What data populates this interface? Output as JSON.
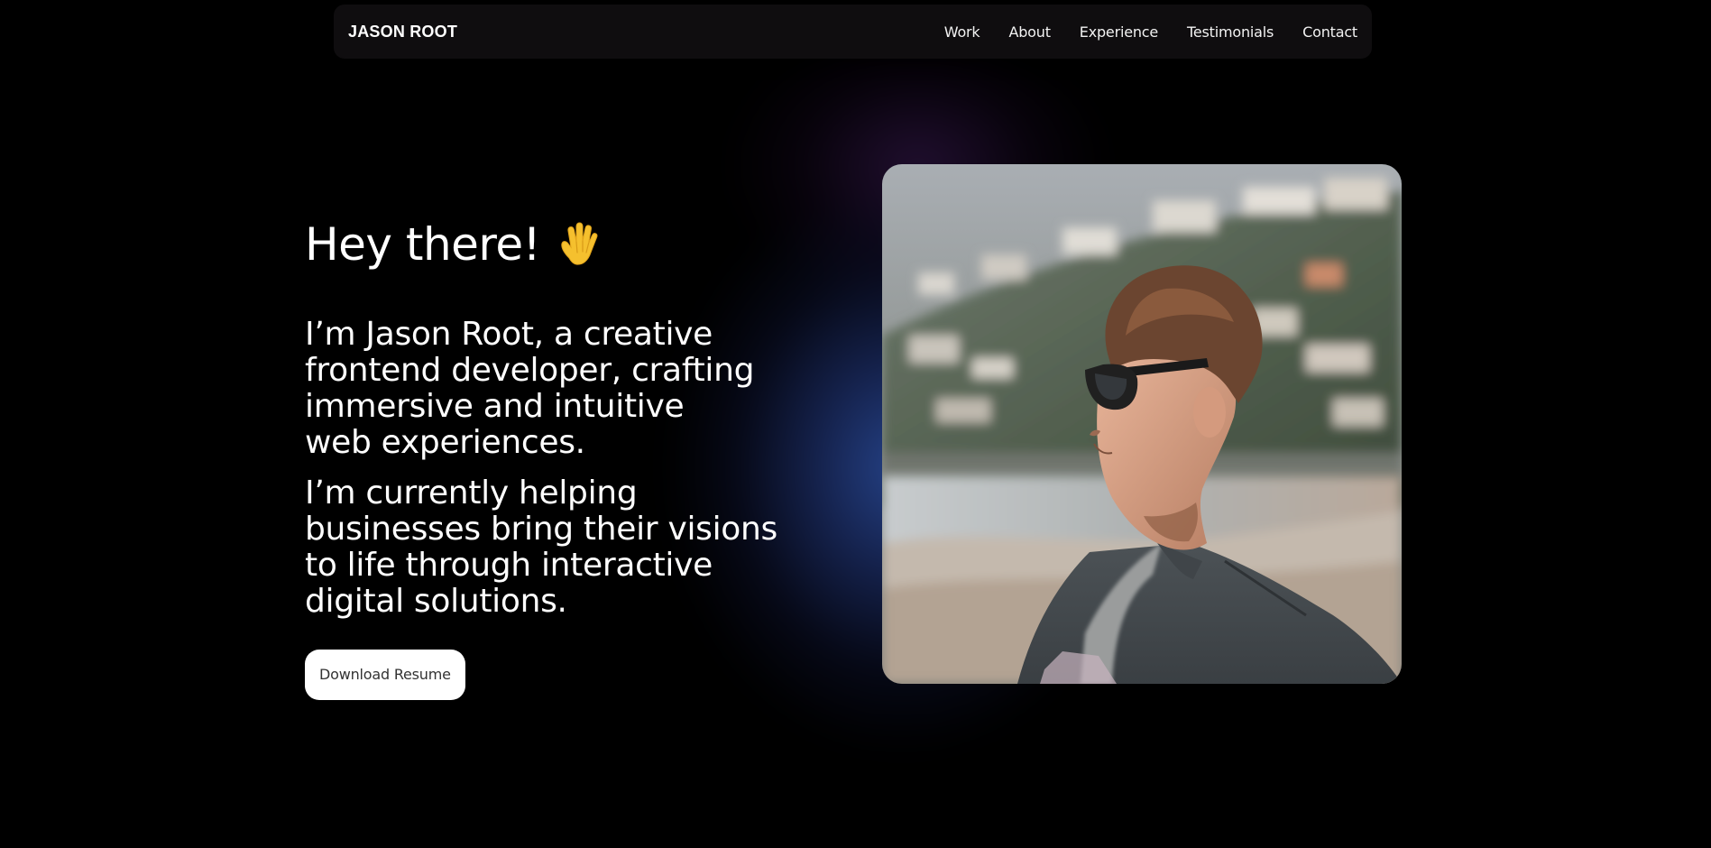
{
  "nav": {
    "logo": "JASON ROOT",
    "links": [
      {
        "label": "Work"
      },
      {
        "label": "About"
      },
      {
        "label": "Experience"
      },
      {
        "label": "Testimonials"
      },
      {
        "label": "Contact"
      }
    ]
  },
  "hero": {
    "greeting": "Hey there!",
    "greeting_icon": "raised-hand-icon",
    "intro": "I’m Jason Root, a creative frontend developer, crafting immersive and intuitive web experiences.",
    "current": "I’m currently helping businesses bring their visions to life through interactive digital solutions.",
    "button_label": "Download Resume"
  },
  "colors": {
    "background": "#000000",
    "glow_blue": "#3056B0",
    "glow_purple": "#6E32A0",
    "button_bg": "#FFFFFF",
    "button_text": "#333333"
  }
}
